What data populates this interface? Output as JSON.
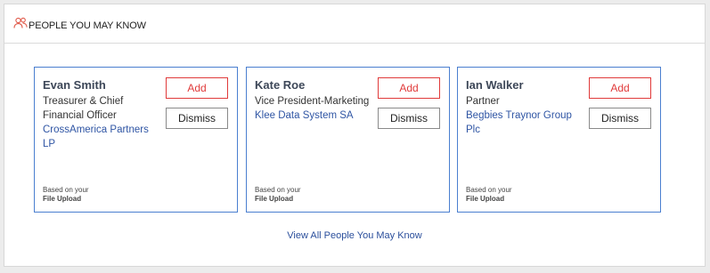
{
  "header": {
    "title": "PEOPLE YOU MAY KNOW",
    "icon": "people-icon",
    "icon_color": "#e05a4a"
  },
  "cards": [
    {
      "name": "Evan Smith",
      "title": "Treasurer & Chief Financial Officer",
      "company": "CrossAmerica Partners LP",
      "add_label": "Add",
      "dismiss_label": "Dismiss",
      "basis_label": "Based on your",
      "basis_source": "File Upload"
    },
    {
      "name": "Kate Roe",
      "title": "Vice President-Marketing",
      "company": "Klee Data System SA",
      "add_label": "Add",
      "dismiss_label": "Dismiss",
      "basis_label": "Based on your",
      "basis_source": "File Upload"
    },
    {
      "name": "Ian Walker",
      "title": "Partner",
      "company": "Begbies Traynor Group Plc",
      "add_label": "Add",
      "dismiss_label": "Dismiss",
      "basis_label": "Based on your",
      "basis_source": "File Upload"
    }
  ],
  "footer": {
    "view_all_label": "View All People You May Know"
  },
  "colors": {
    "card_border": "#4a7fd0",
    "add_button": "#e03a3a",
    "link": "#2b4f9c"
  }
}
